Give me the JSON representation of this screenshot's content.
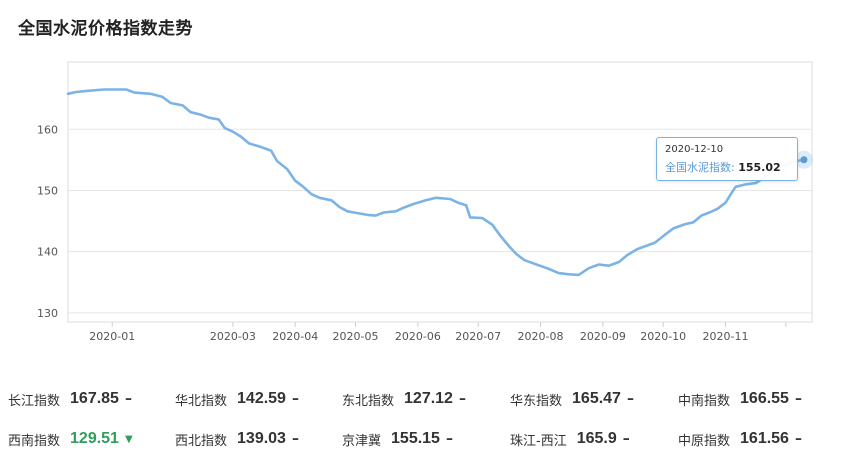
{
  "chart_data": {
    "type": "line",
    "title": "全国水泥价格指数走势",
    "ylim": [
      128.5,
      171
    ],
    "yticks": [
      130,
      140,
      150,
      160
    ],
    "xlim": [
      "2019-12-10",
      "2020-12-14"
    ],
    "xtick_labels": [
      {
        "label": "2020-01",
        "date": "2020-01-01"
      },
      {
        "label": "2020-03",
        "date": "2020-03-01"
      },
      {
        "label": "2020-04",
        "date": "2020-04-01"
      },
      {
        "label": "2020-05",
        "date": "2020-05-01"
      },
      {
        "label": "2020-06",
        "date": "2020-06-01"
      },
      {
        "label": "2020-07",
        "date": "2020-07-01"
      },
      {
        "label": "2020-08",
        "date": "2020-08-01"
      },
      {
        "label": "2020-09",
        "date": "2020-09-01"
      },
      {
        "label": "2020-10",
        "date": "2020-10-01"
      },
      {
        "label": "2020-11",
        "date": "2020-11-01"
      }
    ],
    "grid": true,
    "series": [
      {
        "name": "全国水泥指数",
        "color": "#7cb3e6",
        "points": [
          [
            "2019-12-10",
            165.8
          ],
          [
            "2019-12-14",
            166.1
          ],
          [
            "2019-12-20",
            166.3
          ],
          [
            "2019-12-28",
            166.5
          ],
          [
            "2020-01-08",
            166.5
          ],
          [
            "2020-01-12",
            166.0
          ],
          [
            "2020-01-20",
            165.8
          ],
          [
            "2020-01-26",
            165.3
          ],
          [
            "2020-01-30",
            164.3
          ],
          [
            "2020-02-05",
            163.9
          ],
          [
            "2020-02-09",
            162.8
          ],
          [
            "2020-02-14",
            162.4
          ],
          [
            "2020-02-18",
            161.9
          ],
          [
            "2020-02-23",
            161.6
          ],
          [
            "2020-02-26",
            160.2
          ],
          [
            "2020-03-01",
            159.6
          ],
          [
            "2020-03-05",
            158.8
          ],
          [
            "2020-03-09",
            157.7
          ],
          [
            "2020-03-15",
            157.1
          ],
          [
            "2020-03-20",
            156.5
          ],
          [
            "2020-03-23",
            154.8
          ],
          [
            "2020-03-28",
            153.5
          ],
          [
            "2020-04-01",
            151.6
          ],
          [
            "2020-04-05",
            150.6
          ],
          [
            "2020-04-09",
            149.4
          ],
          [
            "2020-04-13",
            148.8
          ],
          [
            "2020-04-19",
            148.4
          ],
          [
            "2020-04-23",
            147.3
          ],
          [
            "2020-04-27",
            146.6
          ],
          [
            "2020-05-02",
            146.3
          ],
          [
            "2020-05-07",
            146.0
          ],
          [
            "2020-05-11",
            145.9
          ],
          [
            "2020-05-15",
            146.4
          ],
          [
            "2020-05-21",
            146.6
          ],
          [
            "2020-05-25",
            147.2
          ],
          [
            "2020-05-30",
            147.8
          ],
          [
            "2020-06-05",
            148.4
          ],
          [
            "2020-06-10",
            148.8
          ],
          [
            "2020-06-17",
            148.6
          ],
          [
            "2020-06-21",
            148.0
          ],
          [
            "2020-06-25",
            147.6
          ],
          [
            "2020-06-27",
            145.6
          ],
          [
            "2020-07-03",
            145.5
          ],
          [
            "2020-07-08",
            144.4
          ],
          [
            "2020-07-12",
            142.6
          ],
          [
            "2020-07-16",
            141.0
          ],
          [
            "2020-07-20",
            139.6
          ],
          [
            "2020-07-24",
            138.6
          ],
          [
            "2020-07-30",
            137.9
          ],
          [
            "2020-08-05",
            137.2
          ],
          [
            "2020-08-10",
            136.5
          ],
          [
            "2020-08-15",
            136.3
          ],
          [
            "2020-08-20",
            136.2
          ],
          [
            "2020-08-25",
            137.3
          ],
          [
            "2020-08-30",
            137.9
          ],
          [
            "2020-09-04",
            137.7
          ],
          [
            "2020-09-09",
            138.3
          ],
          [
            "2020-09-13",
            139.4
          ],
          [
            "2020-09-18",
            140.4
          ],
          [
            "2020-09-23",
            141.0
          ],
          [
            "2020-09-27",
            141.5
          ],
          [
            "2020-10-02",
            142.8
          ],
          [
            "2020-10-06",
            143.8
          ],
          [
            "2020-10-12",
            144.5
          ],
          [
            "2020-10-16",
            144.8
          ],
          [
            "2020-10-20",
            145.9
          ],
          [
            "2020-10-24",
            146.4
          ],
          [
            "2020-10-28",
            147.0
          ],
          [
            "2020-11-01",
            148.0
          ],
          [
            "2020-11-04",
            149.6
          ],
          [
            "2020-11-06",
            150.6
          ],
          [
            "2020-11-11",
            151.0
          ],
          [
            "2020-11-16",
            151.2
          ],
          [
            "2020-11-22",
            152.5
          ],
          [
            "2020-11-27",
            153.6
          ],
          [
            "2020-12-02",
            154.4
          ],
          [
            "2020-12-06",
            154.8
          ],
          [
            "2020-12-10",
            155.02
          ]
        ]
      }
    ],
    "tooltip": {
      "date": "2020-12-10",
      "series_name": "全国水泥指数",
      "label": "全国水泥指数:",
      "value": "155.02"
    },
    "stats": [
      {
        "name": "长江指数",
        "value": "167.85",
        "trend": "–"
      },
      {
        "name": "华北指数",
        "value": "142.59",
        "trend": "–"
      },
      {
        "name": "东北指数",
        "value": "127.12",
        "trend": "–"
      },
      {
        "name": "华东指数",
        "value": "165.47",
        "trend": "–"
      },
      {
        "name": "中南指数",
        "value": "166.55",
        "trend": "–"
      },
      {
        "name": "西南指数",
        "value": "129.51",
        "trend": "▼",
        "direction": "down"
      },
      {
        "name": "西北指数",
        "value": "139.03",
        "trend": "–"
      },
      {
        "name": "京津冀",
        "value": "155.15",
        "trend": "–"
      },
      {
        "name": "珠江-西江",
        "value": "165.9",
        "trend": "–"
      },
      {
        "name": "中原指数",
        "value": "161.56",
        "trend": "–"
      }
    ]
  }
}
